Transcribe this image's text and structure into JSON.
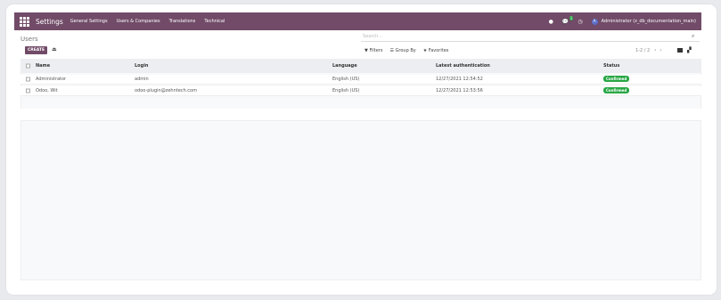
{
  "navbar": {
    "brand": "Settings",
    "menu": [
      "General Settings",
      "Users & Companies",
      "Translations",
      "Technical"
    ],
    "chat_count": "1",
    "avatar_letter": "A",
    "user": "Administrator (z_db_documentation_main)",
    "color": "#714b67"
  },
  "breadcrumb": "Users",
  "search": {
    "placeholder": "Search..."
  },
  "toolbar": {
    "create_label": "CREATE"
  },
  "filters": {
    "filters_label": "Filters",
    "group_by_label": "Group By",
    "favorites_label": "Favorites"
  },
  "pager": {
    "text": "1-2 / 2"
  },
  "table": {
    "columns": [
      "Name",
      "Login",
      "Language",
      "Latest authentication",
      "Status"
    ],
    "rows": [
      {
        "name": "Administrator",
        "login": "admin",
        "language": "English (US)",
        "auth": "12/27/2021 12:54:52",
        "status": "Confirmed"
      },
      {
        "name": "Odoo, Wit",
        "login": "odoo-plugin@zehntech.com",
        "language": "English (US)",
        "auth": "12/27/2021 12:53:56",
        "status": "Confirmed"
      }
    ]
  }
}
